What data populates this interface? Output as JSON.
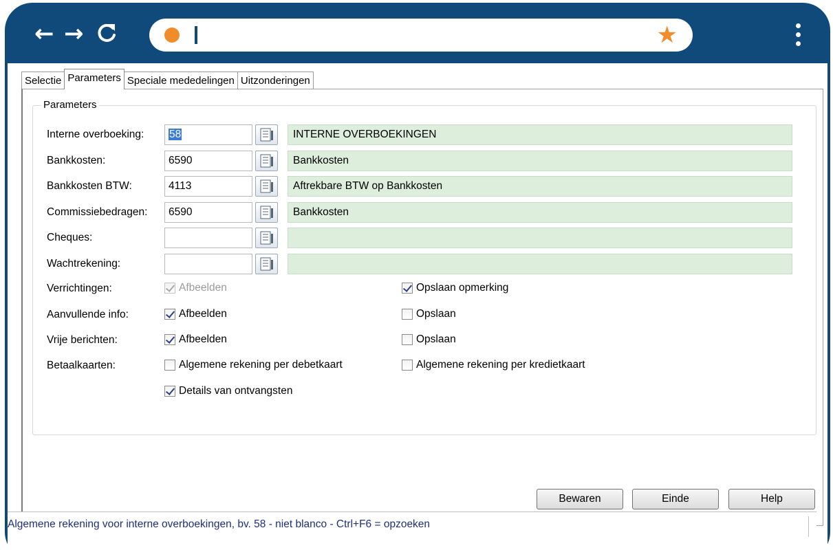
{
  "browser": {
    "back_icon": "arrow-left-icon",
    "forward_icon": "arrow-right-icon",
    "reload_icon": "reload-icon",
    "url_value": "",
    "bookmark_icon": "star-icon",
    "menu_icon": "kebab-menu-icon",
    "frame_color": "#0f4a7a",
    "accent_color": "#f08c2a"
  },
  "tabs": [
    {
      "label": "Selectie",
      "active": false
    },
    {
      "label": "Parameters",
      "active": true
    },
    {
      "label": "Speciale mededelingen",
      "active": false
    },
    {
      "label": "Uitzonderingen",
      "active": false
    }
  ],
  "group": {
    "legend": "Parameters"
  },
  "accounts": [
    {
      "label": "Interne overboeking:",
      "code": "58",
      "description": "INTERNE OVERBOEKINGEN"
    },
    {
      "label": "Bankkosten:",
      "code": "6590",
      "description": "Bankkosten"
    },
    {
      "label": "Bankkosten BTW:",
      "code": "4113",
      "description": "Aftrekbare BTW op Bankkosten"
    },
    {
      "label": "Commissiebedragen:",
      "code": "6590",
      "description": "Bankkosten"
    },
    {
      "label": "Cheques:",
      "code": "",
      "description": ""
    },
    {
      "label": "Wachtrekening:",
      "code": "",
      "description": ""
    }
  ],
  "options": {
    "verrichtingen": {
      "label": "Verrichtingen:",
      "afbeelden": "Afbeelden",
      "opslaan": "Opslaan opmerking"
    },
    "aanvullende": {
      "label": "Aanvullende info:",
      "afbeelden": "Afbeelden",
      "opslaan": "Opslaan"
    },
    "vrije": {
      "label": "Vrije berichten:",
      "afbeelden": "Afbeelden",
      "opslaan": "Opslaan"
    },
    "betaalkaarten": {
      "label": "Betaalkaarten:",
      "debet": "Algemene rekening per debetkaart",
      "krediet": "Algemene rekening per kredietkaart",
      "details": "Details van ontvangsten"
    }
  },
  "buttons": {
    "save": "Bewaren",
    "end": "Einde",
    "help": "Help"
  },
  "status": {
    "text": "Algemene rekening voor interne overboekingen, bv. 58 - niet blanco - Ctrl+F6 = opzoeken"
  },
  "colors": {
    "description_bg": "#deeedd",
    "status_text": "#1d2f7a",
    "selection": "#3a7bd5"
  }
}
